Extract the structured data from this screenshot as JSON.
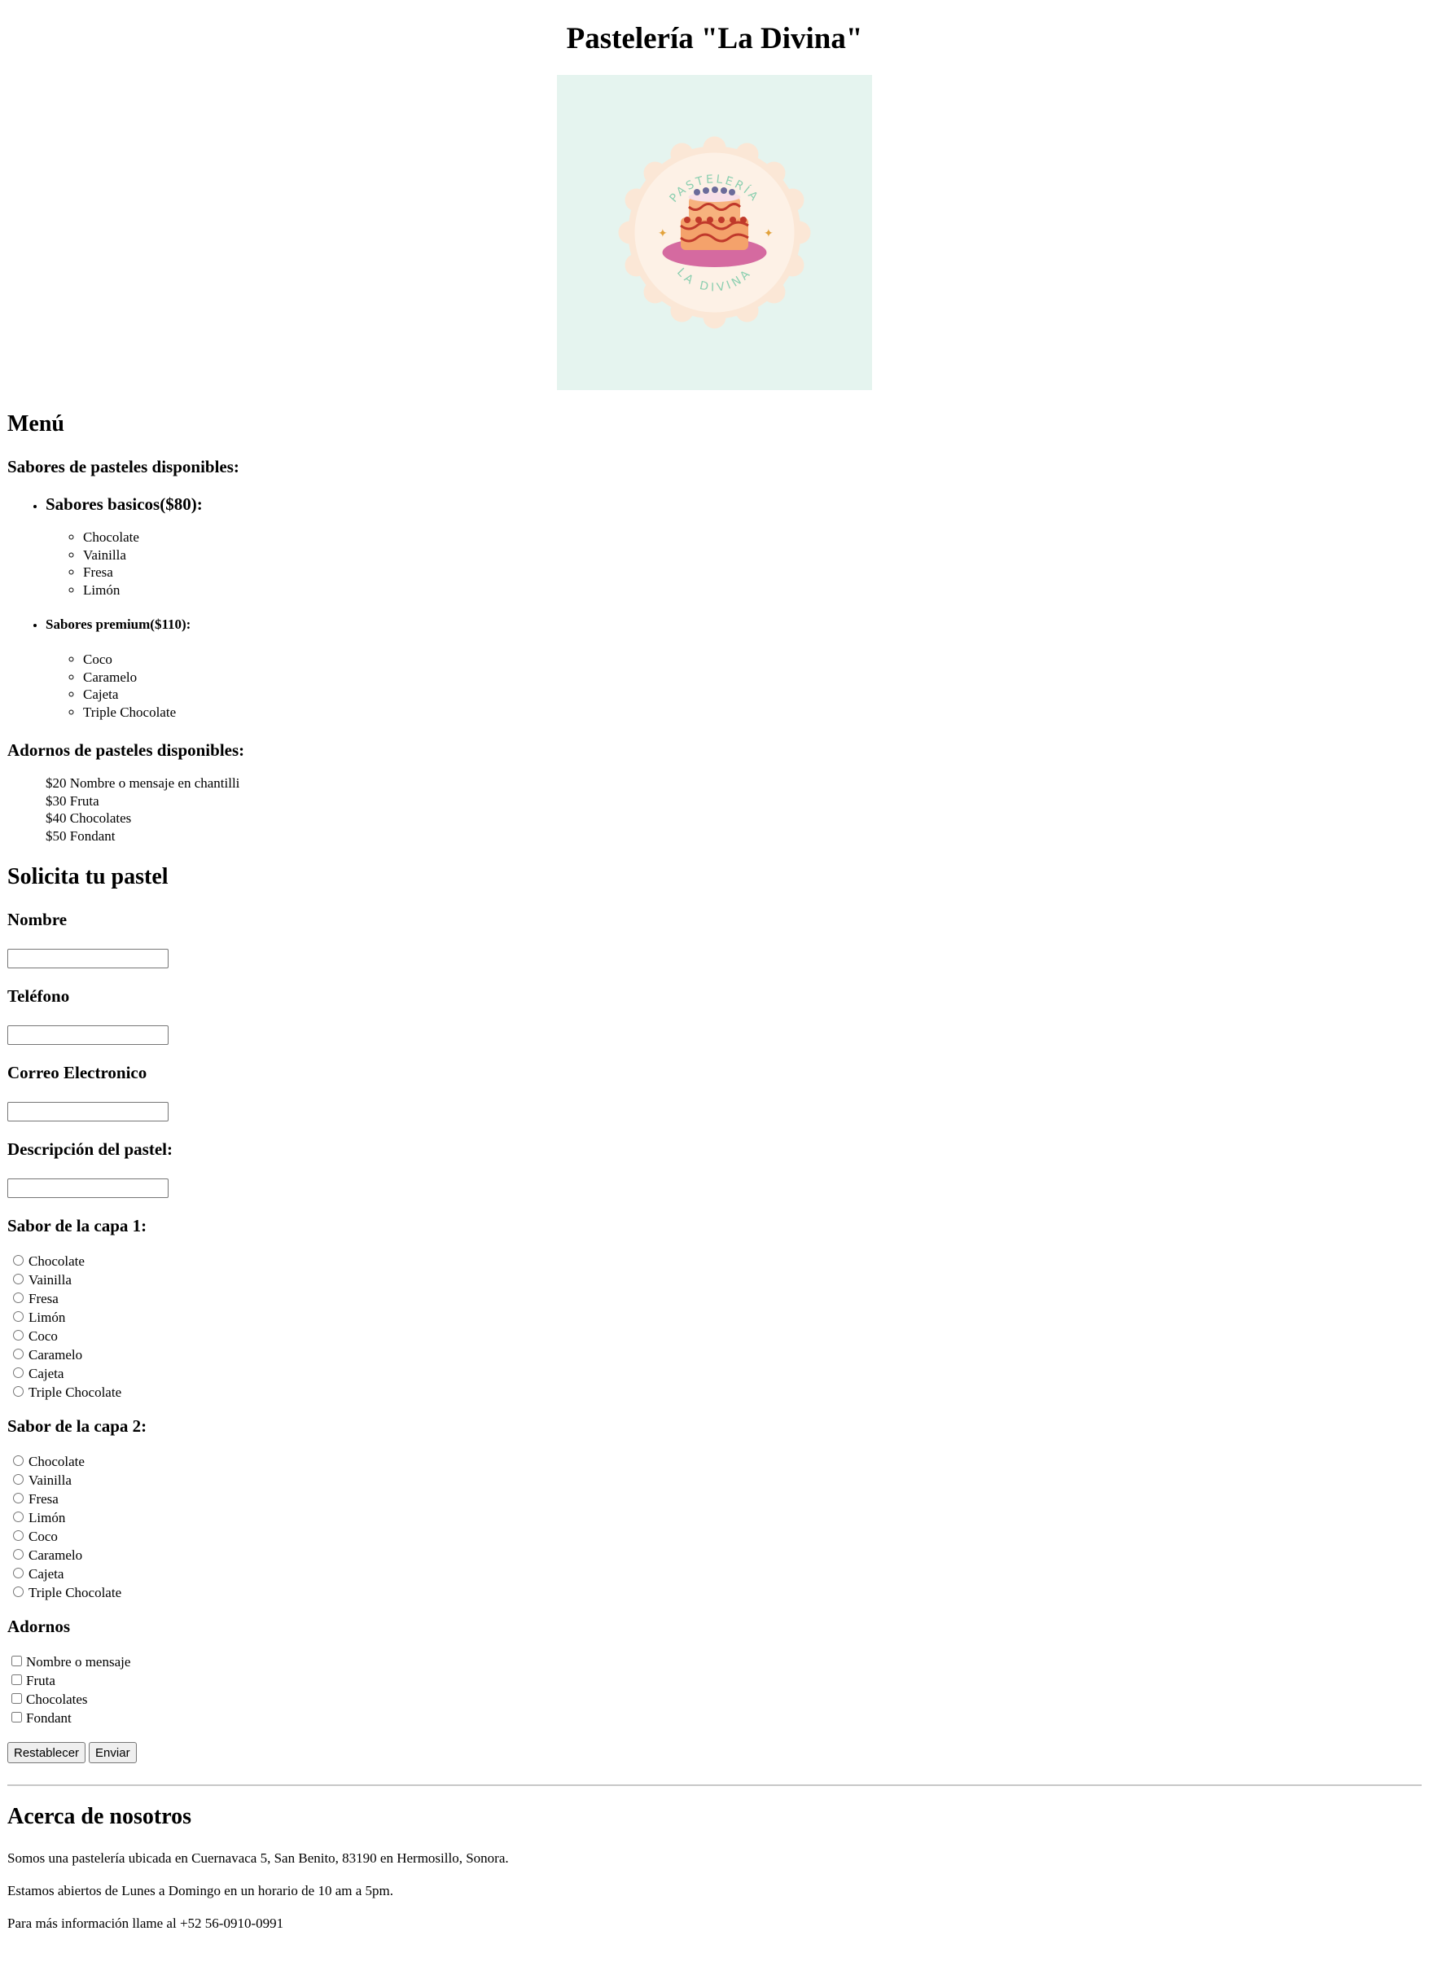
{
  "header": {
    "title": "Pastelería \"La Divina\""
  },
  "logo": {
    "top_text": "PASTELERÍA",
    "bottom_text": "LA DIVINA",
    "bg_color": "#e5f4ef"
  },
  "menu": {
    "heading": "Menú",
    "flavors_heading": "Sabores de pasteles disponibles:",
    "basic": {
      "title": "Sabores basicos($80):",
      "items": [
        "Chocolate",
        "Vainilla",
        "Fresa",
        "Limón"
      ]
    },
    "premium": {
      "title": "Sabores premium($110):",
      "items": [
        "Coco",
        "Caramelo",
        "Cajeta",
        "Triple Chocolate"
      ]
    },
    "decor_heading": "Adornos de pasteles disponibles:",
    "decor_items": [
      "$20 Nombre o mensaje en chantilli",
      "$30 Fruta",
      "$40 Chocolates",
      "$50 Fondant"
    ]
  },
  "form": {
    "heading": "Solicita tu pastel",
    "name_label": "Nombre",
    "name_value": "",
    "phone_label": "Teléfono",
    "phone_value": "",
    "email_label": "Correo Electronico",
    "email_value": "",
    "desc_label": "Descripción del pastel:",
    "desc_value": "",
    "layer1_label": "Sabor de la capa 1:",
    "layer2_label": "Sabor de la capa 2:",
    "flavors": [
      "Chocolate",
      "Vainilla",
      "Fresa",
      "Limón",
      "Coco",
      "Caramelo",
      "Cajeta",
      "Triple Chocolate"
    ],
    "decor_label": "Adornos",
    "decor_options": [
      "Nombre o mensaje",
      "Fruta",
      "Chocolates",
      "Fondant"
    ],
    "reset_label": "Restablecer",
    "submit_label": "Enviar"
  },
  "about": {
    "heading": "Acerca de nosotros",
    "p1": "Somos una pastelería ubicada en Cuernavaca 5, San Benito, 83190 en Hermosillo, Sonora.",
    "p2": "Estamos abiertos de Lunes a Domingo en un horario de 10 am a 5pm.",
    "p3": "Para más información llame al +52 56-0910-0991"
  }
}
